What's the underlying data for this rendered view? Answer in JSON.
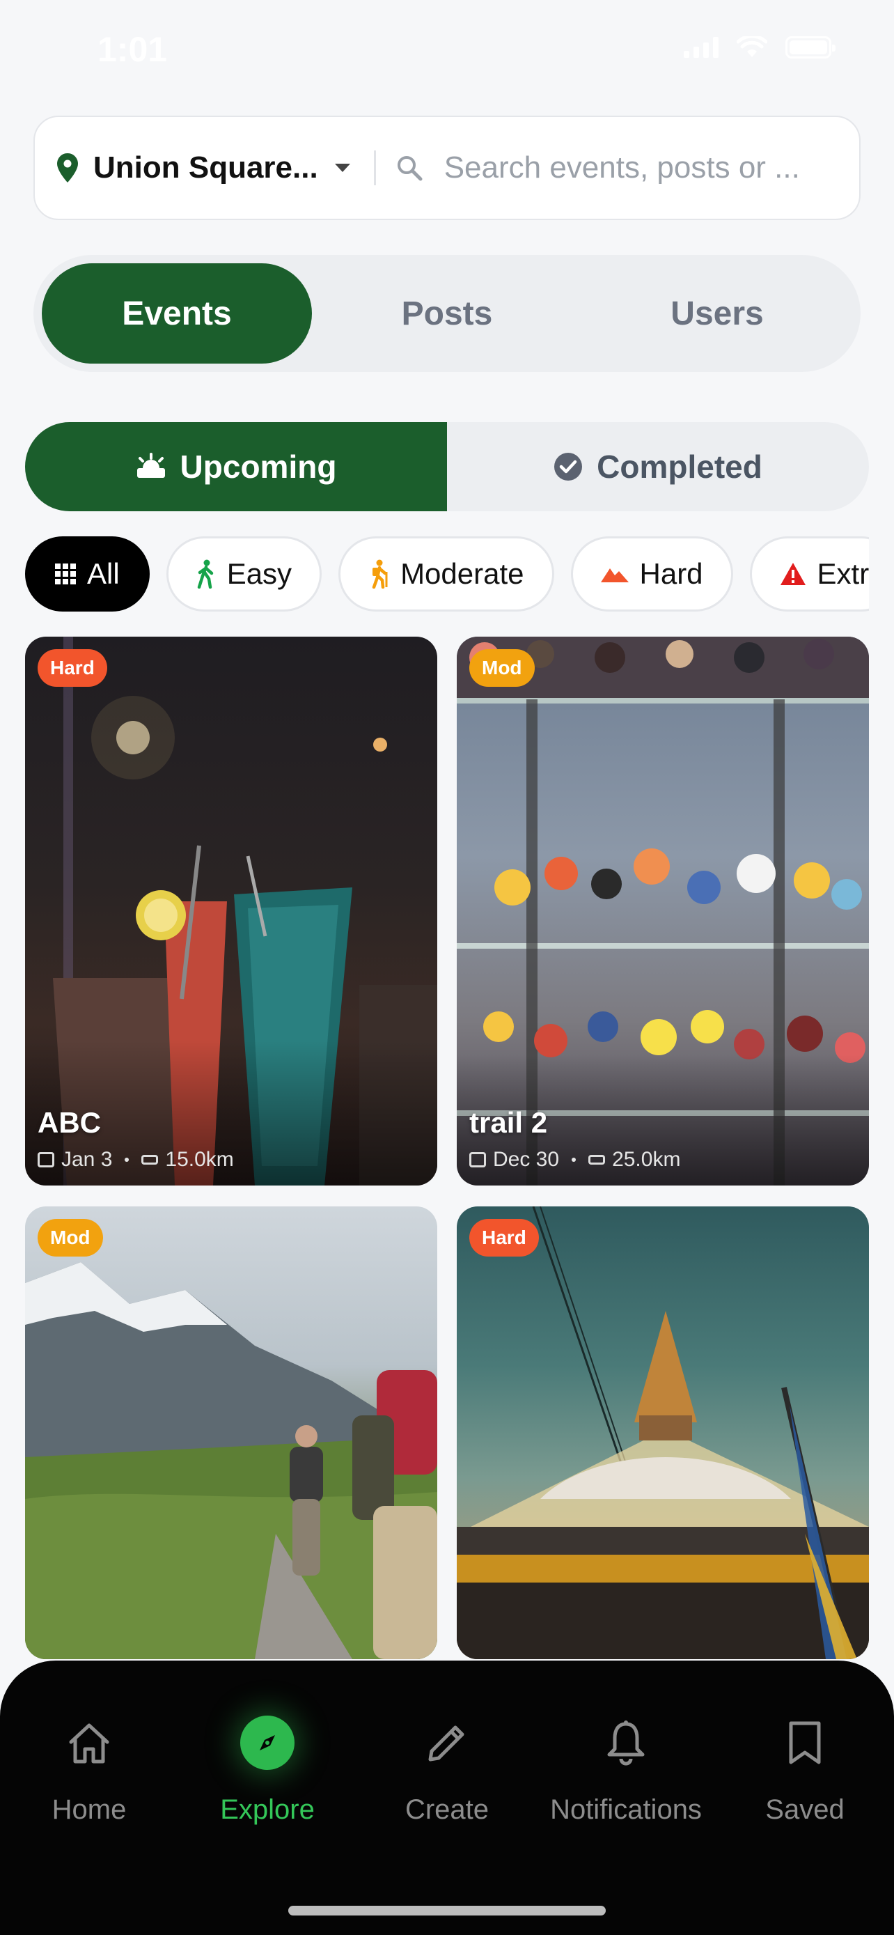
{
  "status_bar": {
    "time": "1:01"
  },
  "search": {
    "location": "Union Square...",
    "placeholder": "Search events, posts or ..."
  },
  "main_tabs": [
    {
      "label": "Events",
      "active": true
    },
    {
      "label": "Posts",
      "active": false
    },
    {
      "label": "Users",
      "active": false
    }
  ],
  "status_toggle": {
    "upcoming": "Upcoming",
    "completed": "Completed",
    "selected": "Upcoming"
  },
  "filters": [
    {
      "label": "All",
      "icon": "grid-icon",
      "active": true
    },
    {
      "label": "Easy",
      "icon": "walking-icon",
      "color": "#16a34a"
    },
    {
      "label": "Moderate",
      "icon": "hiking-icon",
      "color": "#f59e0b"
    },
    {
      "label": "Hard",
      "icon": "mountain-icon",
      "color": "#f2552c"
    },
    {
      "label": "Extr",
      "icon": "warning-icon",
      "color": "#e11d1d"
    }
  ],
  "cards": [
    {
      "badge": "Hard",
      "title": "ABC",
      "date": "Jan 3",
      "distance": "15.0km"
    },
    {
      "badge": "Mod",
      "title": "trail 2",
      "date": "Dec 30",
      "distance": "25.0km"
    },
    {
      "badge": "Mod",
      "title": "",
      "date": "",
      "distance": ""
    },
    {
      "badge": "Hard",
      "title": "",
      "date": "",
      "distance": ""
    }
  ],
  "nav": {
    "home": "Home",
    "explore": "Explore",
    "create": "Create",
    "notifications": "Notifications",
    "saved": "Saved",
    "active": "Explore"
  },
  "colors": {
    "primary": "#1b5e2c",
    "accent_green": "#34c759",
    "hard": "#f2552c",
    "moderate": "#f2a20f"
  }
}
